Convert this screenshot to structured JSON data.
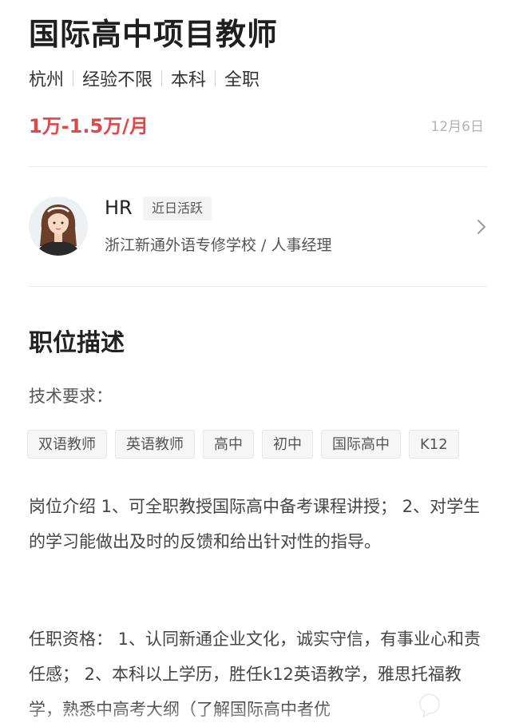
{
  "job": {
    "title": "国际高中项目教师",
    "meta": [
      "杭州",
      "经验不限",
      "本科",
      "全职"
    ],
    "salary": "1万-1.5万/月",
    "date": "12月6日"
  },
  "hr": {
    "name": "HR",
    "badge": "近日活跃",
    "company": "浙江新通外语专修学校 / 人事经理",
    "chevron_icon": "chevron-right-icon"
  },
  "description": {
    "section_title": "职位描述",
    "skills_label": "技术要求：",
    "tags": [
      "双语教师",
      "英语教师",
      "高中",
      "初中",
      "国际高中",
      "K12"
    ],
    "intro": "岗位介绍 1、可全职教授国际高中备考课程讲授；  2、对学生的学习能做出及时的反馈和给出针对性的指导。",
    "requirements": "任职资格： 1、认同新通企业文化，诚实守信，有事业心和责任感； 2、本科以上学历，胜任k12英语教学，雅思托福教学，熟悉中高考大纲（了解国际高中者优"
  },
  "colors": {
    "salary": "#e0474a",
    "date": "#b3b3b3",
    "tag_bg": "#f6f6f6",
    "divider": "#e9e9e9"
  },
  "watermark_icon": "speech-bubble-logo"
}
